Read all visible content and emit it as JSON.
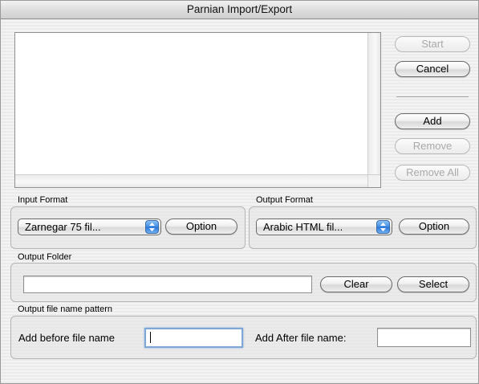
{
  "window": {
    "title": "Parnian Import/Export"
  },
  "buttons": {
    "start": "Start",
    "cancel": "Cancel",
    "add": "Add",
    "remove": "Remove",
    "remove_all": "Remove All"
  },
  "input_format": {
    "label": "Input Format",
    "selected": "Zarnegar 75 fil...",
    "option_button": "Option"
  },
  "output_format": {
    "label": "Output Format",
    "selected": "Arabic HTML fil...",
    "option_button": "Option"
  },
  "output_folder": {
    "label": "Output Folder",
    "value": "",
    "clear_button": "Clear",
    "select_button": "Select"
  },
  "pattern": {
    "label": "Output file name pattern",
    "before_label": "Add before file name",
    "before_value": "",
    "after_label": "Add After file name:",
    "after_value": ""
  },
  "colors": {
    "accent": "#3e8be4",
    "focus_ring": "#7ea7d8"
  }
}
